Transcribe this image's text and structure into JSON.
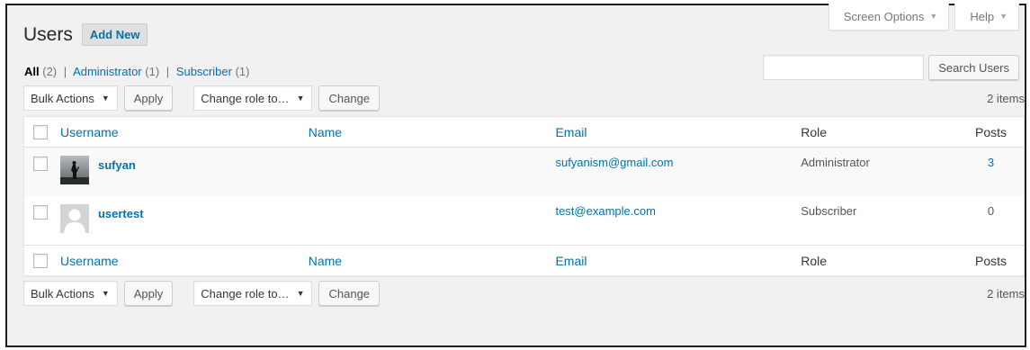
{
  "screen_meta": {
    "screen_options": "Screen Options",
    "help": "Help"
  },
  "header": {
    "title": "Users",
    "add_new": "Add New"
  },
  "filters": {
    "all_label": "All",
    "all_count": "(2)",
    "admin_label": "Administrator",
    "admin_count": "(1)",
    "subscriber_label": "Subscriber",
    "subscriber_count": "(1)",
    "separator": "|"
  },
  "search": {
    "value": "",
    "button": "Search Users"
  },
  "tablenav": {
    "bulk_actions": "Bulk Actions",
    "apply": "Apply",
    "change_role": "Change role to…",
    "change": "Change",
    "items_count": "2 items"
  },
  "columns": {
    "username": "Username",
    "name": "Name",
    "email": "Email",
    "role": "Role",
    "posts": "Posts"
  },
  "users": [
    {
      "username": "sufyan",
      "name": "",
      "email": "sufyanism@gmail.com",
      "role": "Administrator",
      "posts": "3",
      "avatar": "photo-avatar-icon"
    },
    {
      "username": "usertest",
      "name": "",
      "email": "test@example.com",
      "role": "Subscriber",
      "posts": "0",
      "avatar": "default-avatar-icon"
    }
  ],
  "colors": {
    "link": "#0073aa",
    "background": "#f1f1f1",
    "text": "#444444"
  }
}
